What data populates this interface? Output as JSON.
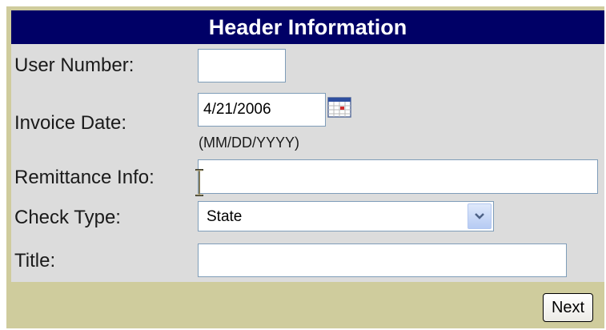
{
  "header": {
    "title": "Header Information"
  },
  "form": {
    "user_number": {
      "label": "User Number:",
      "value": ""
    },
    "invoice_date": {
      "label": "Invoice Date:",
      "value": "4/21/2006",
      "format_hint": "(MM/DD/YYYY)",
      "calendar_icon": "calendar-icon"
    },
    "remittance_info": {
      "label": "Remittance Info:",
      "value": ""
    },
    "check_type": {
      "label": "Check Type:",
      "selected": "State",
      "dropdown_icon": "chevron-down-icon"
    },
    "title": {
      "label": "Title:",
      "value": ""
    }
  },
  "footer": {
    "next_label": "Next"
  },
  "colors": {
    "header_bg": "#000066",
    "panel_bg": "#cfcc9d",
    "form_bg": "#dcdcdc",
    "input_border": "#7f9db9"
  }
}
